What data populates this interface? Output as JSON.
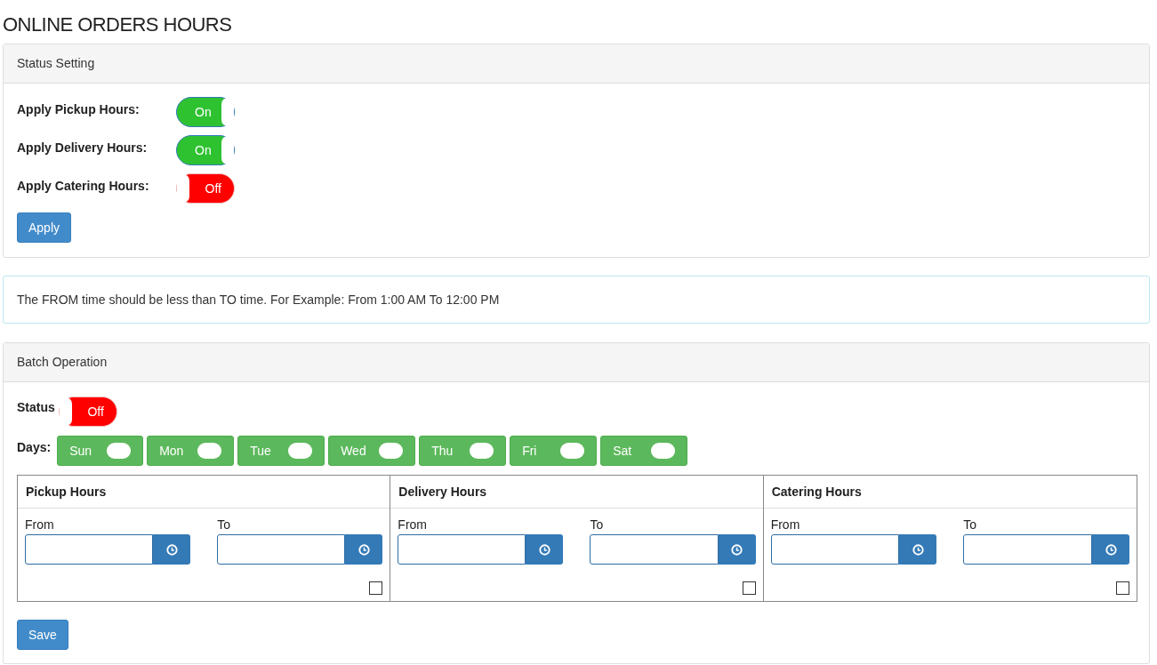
{
  "title": "ONLINE ORDERS HOURS",
  "status_setting": {
    "heading": "Status Setting",
    "toggles": [
      {
        "label": "Apply Pickup Hours:",
        "on": true,
        "text": "On"
      },
      {
        "label": "Apply Delivery Hours:",
        "on": true,
        "text": "On"
      },
      {
        "label": "Apply Catering Hours:",
        "on": false,
        "text": "Off"
      }
    ],
    "button": "Apply"
  },
  "notice": "The FROM time should be less than TO time. For Example: From 1:00 AM To 12:00 PM",
  "batch": {
    "heading": "Batch Operation",
    "status": {
      "label": "Status",
      "on": false,
      "text": "Off"
    },
    "days_label": "Days:",
    "days": [
      "Sun",
      "Mon",
      "Tue",
      "Wed",
      "Thu",
      "Fri",
      "Sat"
    ],
    "columns": [
      {
        "heading": "Pickup Hours",
        "from": "From",
        "to": "To",
        "checked": false
      },
      {
        "heading": "Delivery Hours",
        "from": "From",
        "to": "To",
        "checked": false
      },
      {
        "heading": "Catering Hours",
        "from": "From",
        "to": "To",
        "checked": false
      }
    ],
    "button": "Save"
  }
}
